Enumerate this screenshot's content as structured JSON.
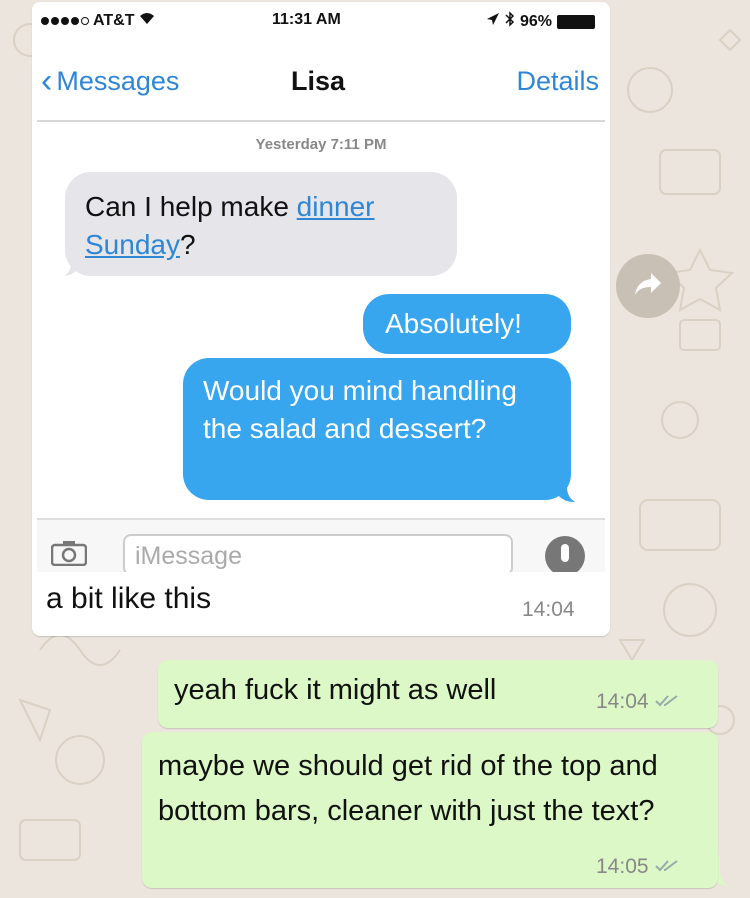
{
  "screenshot": {
    "status": {
      "carrier": "AT&T",
      "time": "11:31 AM",
      "battery": "96%"
    },
    "nav": {
      "back_label": "Messages",
      "title": "Lisa",
      "details_label": "Details"
    },
    "timestamp": "Yesterday 7:11 PM",
    "incoming": {
      "text_before": "Can I help make ",
      "link1": "dinner",
      "link2": "Sunday",
      "text_after": "?"
    },
    "outgoing": [
      "Absolutely!",
      "Would you mind handling the salad and dessert?"
    ],
    "input_placeholder": "iMessage"
  },
  "received_message": {
    "caption": "a bit like this",
    "time": "14:04"
  },
  "sent_messages": [
    {
      "text": "yeah fuck it might as well",
      "time": "14:04"
    },
    {
      "text": "maybe we should get rid of the top and bottom bars, cleaner with just the text?",
      "time": "14:05"
    }
  ],
  "colors": {
    "wallpaper": "#ECE5DD",
    "sent_bubble": "#DCF8C6",
    "imessage_blue": "#38A5EF",
    "imessage_gray": "#E5E5EA",
    "link_blue": "#2F86D5"
  }
}
